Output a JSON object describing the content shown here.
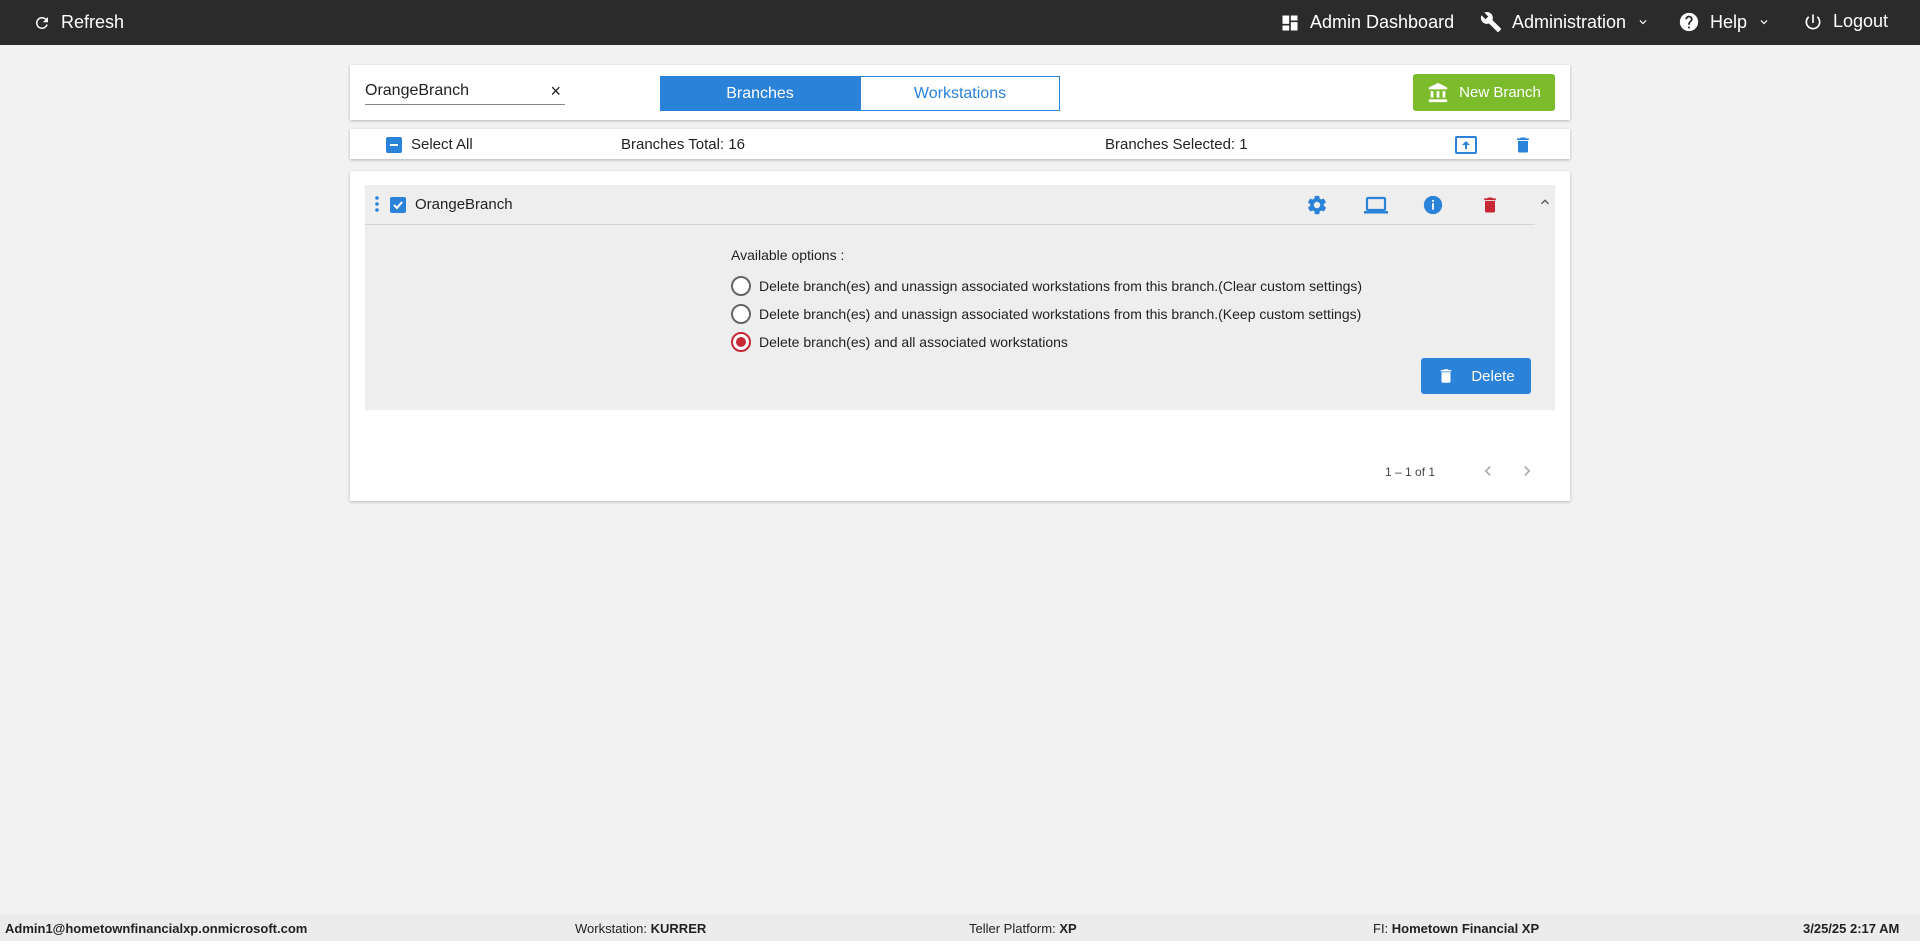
{
  "topbar": {
    "refresh": "Refresh",
    "admin_dashboard": "Admin Dashboard",
    "administration": "Administration",
    "help": "Help",
    "logout": "Logout"
  },
  "toolbar": {
    "search_value": "OrangeBranch",
    "clear": "×",
    "tabs": [
      {
        "label": "Branches",
        "active": true
      },
      {
        "label": "Workstations",
        "active": false
      }
    ],
    "new_branch": "New Branch"
  },
  "selectbar": {
    "select_all": "Select All",
    "total": "Branches Total: 16",
    "selected": "Branches Selected: 1"
  },
  "branch": {
    "name": "OrangeBranch",
    "options_title": "Available options :",
    "options": [
      {
        "label": "Delete branch(es) and unassign associated workstations from this branch.(Clear custom settings)",
        "selected": false
      },
      {
        "label": "Delete branch(es) and unassign associated workstations from this branch.(Keep custom settings)",
        "selected": false
      },
      {
        "label": "Delete branch(es) and all associated workstations",
        "selected": true
      }
    ],
    "delete_label": "Delete"
  },
  "pager": {
    "range": "1 – 1 of 1"
  },
  "footer": {
    "user": "Admin1@hometownfinancialxp.onmicrosoft.com",
    "workstation_label": "Workstation:",
    "workstation": "KURRER",
    "platform_label": "Teller Platform:",
    "platform": "XP",
    "fi_label": "FI:",
    "fi": "Hometown Financial XP",
    "datetime": "3/25/25 2:17 AM"
  },
  "colors": {
    "accent": "#2a82d9",
    "success": "#7cbb2c",
    "danger": "#c62836",
    "topbar": "#2b2b2b"
  }
}
